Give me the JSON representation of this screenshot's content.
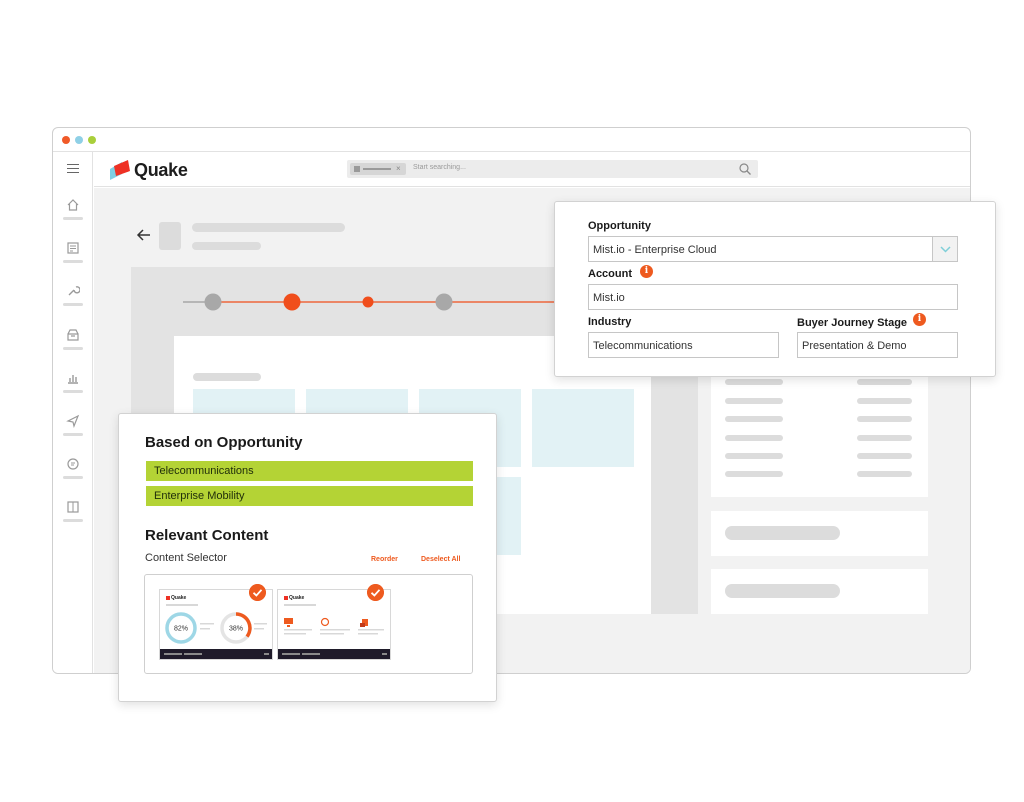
{
  "app": {
    "brand": "Quake"
  },
  "colors": {
    "accent": "#ee5a1f",
    "tag": "#b4d335",
    "progress_active": "#f04e1c",
    "progress_inactive": "#a8a8a8"
  },
  "header": {
    "search_placeholder": "Start searching...",
    "search_chip_close": "×"
  },
  "sidebar": {
    "items": [
      {
        "icon": "home-icon"
      },
      {
        "icon": "document-icon"
      },
      {
        "icon": "wrench-icon"
      },
      {
        "icon": "inbox-icon"
      },
      {
        "icon": "bar-chart-icon"
      },
      {
        "icon": "send-icon"
      },
      {
        "icon": "chat-icon"
      },
      {
        "icon": "book-icon"
      }
    ]
  },
  "opportunity_form": {
    "opportunity_label": "Opportunity",
    "opportunity_value": "Mist.io - Enterprise Cloud",
    "account_label": "Account",
    "account_value": "Mist.io",
    "industry_label": "Industry",
    "industry_value": "Telecommunications",
    "stage_label": "Buyer Journey Stage",
    "stage_value": "Presentation & Demo",
    "info_glyph": "i"
  },
  "relevant": {
    "based_on_title": "Based on Opportunity",
    "tags": [
      "Telecommunications",
      "Enterprise Mobility"
    ],
    "relevant_title": "Relevant Content",
    "selector_label": "Content Selector",
    "reorder_label": "Reorder",
    "deselect_label": "Deselect All",
    "thumbnails": [
      {
        "logo": "Quake",
        "gauge1": "82%",
        "gauge2": "38%"
      },
      {
        "logo": "Quake"
      }
    ]
  }
}
